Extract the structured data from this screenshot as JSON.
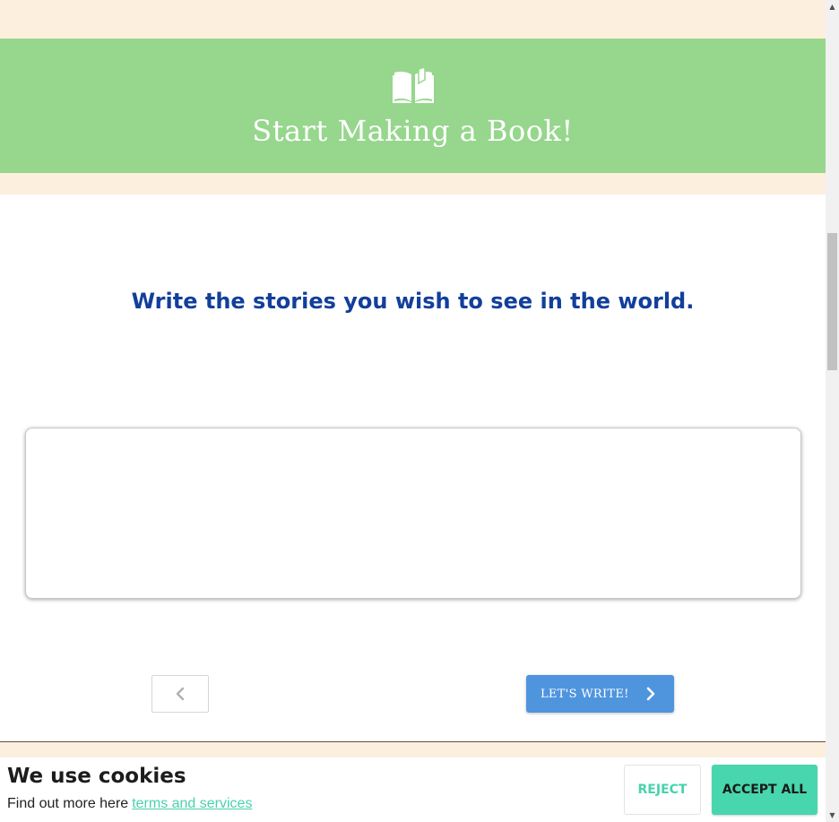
{
  "hero": {
    "icon": "open-book-icon",
    "title": "Start Making a Book!"
  },
  "main": {
    "tagline": "Write the stories you wish to see in the world.",
    "story_box_text": "",
    "prev_icon": "chevron-left-icon",
    "next_label": "LET'S WRITE!",
    "next_icon": "chevron-right-icon"
  },
  "cookie": {
    "title": "We use cookies",
    "text": "Find out more here",
    "link": "terms and services",
    "reject_label": "REJECT",
    "accept_label": "ACCEPT ALL"
  },
  "colors": {
    "hero_bg": "#97d68d",
    "page_bg": "#fdefdd",
    "tagline": "#123f9a",
    "primary_button": "#4f95de",
    "accent": "#47d6ad"
  }
}
